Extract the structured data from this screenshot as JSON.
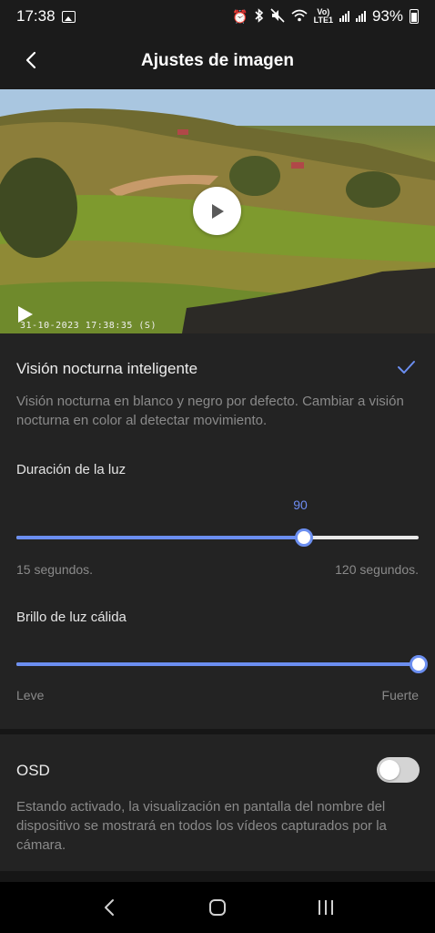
{
  "status_bar": {
    "time": "17:38",
    "network_label": "Vo)",
    "network_sub": "LTE1",
    "battery": "93%"
  },
  "header": {
    "title": "Ajustes de imagen"
  },
  "video": {
    "timestamp": "31-10-2023 17:38:35 (S)"
  },
  "night_vision": {
    "title": "Visión nocturna inteligente",
    "enabled": true,
    "description": "Visión nocturna en blanco y negro por defecto. Cambiar a visión nocturna en color al detectar movimiento."
  },
  "light_duration": {
    "label": "Duración de la luz",
    "value": "90",
    "min_label": "15 segundos.",
    "max_label": "120 segundos.",
    "min": 15,
    "max": 120,
    "current": 90
  },
  "warm_light": {
    "label": "Brillo de luz cálida",
    "min_label": "Leve",
    "max_label": "Fuerte",
    "level": 1.0
  },
  "osd": {
    "title": "OSD",
    "enabled": false,
    "description": "Estando activado, la visualización en pantalla del nombre del dispositivo se mostrará en todos los vídeos capturados por la cámara."
  },
  "colors": {
    "accent": "#6b8ef0",
    "background": "#232323"
  }
}
